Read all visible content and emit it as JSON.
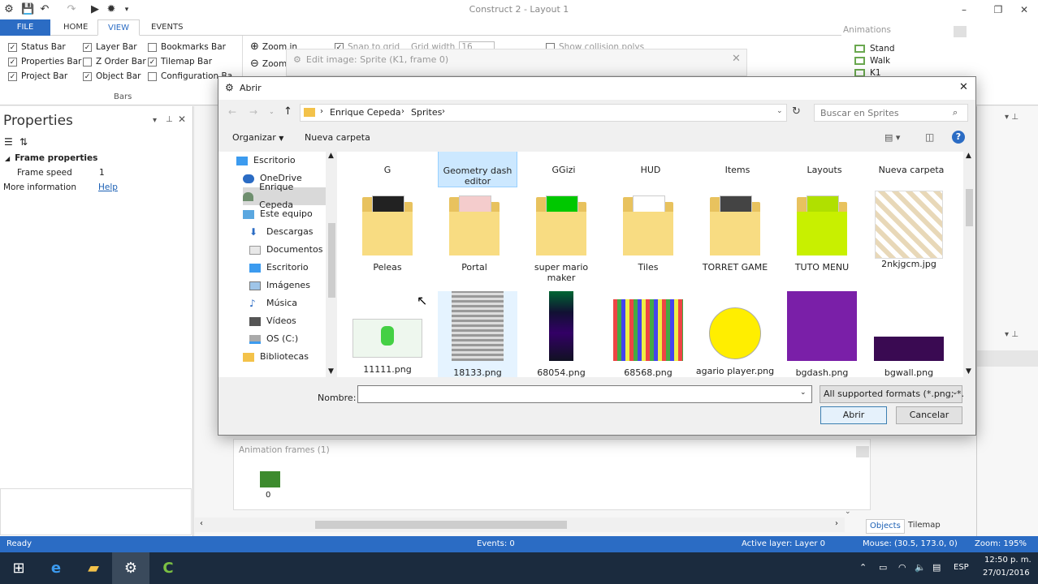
{
  "app": {
    "title": "Construct 2 - Layout 1"
  },
  "ribbon": {
    "tabs": [
      "FILE",
      "HOME",
      "VIEW",
      "EVENTS"
    ],
    "active_tab": "VIEW",
    "bars_group": {
      "label": "Bars",
      "col1": [
        {
          "label": "Status Bar",
          "checked": true
        },
        {
          "label": "Properties Bar",
          "checked": true
        },
        {
          "label": "Project Bar",
          "checked": true
        }
      ],
      "col2": [
        {
          "label": "Layer Bar",
          "checked": true
        },
        {
          "label": "Z Order Bar",
          "checked": false
        },
        {
          "label": "Object Bar",
          "checked": true
        }
      ],
      "col3": [
        {
          "label": "Bookmarks Bar",
          "checked": false
        },
        {
          "label": "Tilemap Bar",
          "checked": true
        },
        {
          "label": "Configuration Ba",
          "checked": false
        }
      ]
    },
    "zoom_in": "Zoom in",
    "zoom_out": "Zoom",
    "snap_to_grid": "Snap to grid",
    "grid_width": "Grid width",
    "grid_width_value": "16",
    "show_collision": "Show collision polys"
  },
  "edit_image": {
    "title": "Edit image: Sprite (K1, frame 0)"
  },
  "animations": {
    "title": "Animations",
    "items": [
      "Stand",
      "Walk",
      "K1"
    ]
  },
  "properties": {
    "title": "Properties",
    "section": "Frame properties",
    "rows": [
      {
        "label": "Frame speed",
        "value": "1"
      }
    ],
    "more_info_label": "More information",
    "more_info_link": "Help"
  },
  "anim_frames": {
    "title": "Animation frames (1)",
    "frame_label": "0"
  },
  "right_tabs": {
    "objects": "Objects",
    "tilemap": "Tilemap"
  },
  "status": {
    "ready": "Ready",
    "events": "Events: 0",
    "active_layer": "Active layer: Layer 0",
    "mouse": "Mouse: (30.5, 173.0, 0)",
    "zoom": "Zoom: 195%"
  },
  "dialog": {
    "title": "Abrir",
    "breadcrumb": [
      "Enrique Cepeda",
      "Sprites"
    ],
    "search_placeholder": "Buscar en Sprites",
    "organize": "Organizar",
    "new_folder": "Nueva carpeta",
    "nav": [
      {
        "label": "Escritorio",
        "icon": "desktop-icon",
        "indent": 0
      },
      {
        "label": "OneDrive",
        "icon": "cloud-icon",
        "indent": 1
      },
      {
        "label": "Enrique Cepeda",
        "icon": "user-icon",
        "indent": 1,
        "selected": true
      },
      {
        "label": "Este equipo",
        "icon": "computer-icon",
        "indent": 1
      },
      {
        "label": "Descargas",
        "icon": "download-icon",
        "indent": 2
      },
      {
        "label": "Documentos",
        "icon": "documents-icon",
        "indent": 2
      },
      {
        "label": "Escritorio",
        "icon": "desktop-icon",
        "indent": 2
      },
      {
        "label": "Imágenes",
        "icon": "pictures-icon",
        "indent": 2
      },
      {
        "label": "Música",
        "icon": "music-icon",
        "indent": 2
      },
      {
        "label": "Vídeos",
        "icon": "videos-icon",
        "indent": 2
      },
      {
        "label": "OS (C:)",
        "icon": "drive-icon",
        "indent": 2
      },
      {
        "label": "Bibliotecas",
        "icon": "library-icon",
        "indent": 1
      }
    ],
    "row0": [
      "G",
      "Geometry dash editor",
      "GGizi",
      "HUD",
      "Items",
      "Layouts",
      "Nueva carpeta"
    ],
    "row1": [
      {
        "label": "Peleas",
        "kind": "folder"
      },
      {
        "label": "Portal",
        "kind": "folder"
      },
      {
        "label": "super mario maker",
        "kind": "folder"
      },
      {
        "label": "Tiles",
        "kind": "folder"
      },
      {
        "label": "TORRET GAME",
        "kind": "folder"
      },
      {
        "label": "TUTO MENU",
        "kind": "folder"
      },
      {
        "label": "2nkjgcm.jpg",
        "kind": "image"
      }
    ],
    "row2": [
      {
        "label": "11111.png"
      },
      {
        "label": "18133.png"
      },
      {
        "label": "68054.png"
      },
      {
        "label": "68568.png"
      },
      {
        "label": "agario player.png"
      },
      {
        "label": "bgdash.png"
      },
      {
        "label": "bgwall.png"
      }
    ],
    "filename_label": "Nombre:",
    "filename_value": "",
    "filter": "All supported formats (*.png; *.",
    "open_button": "Abrir",
    "cancel_button": "Cancelar"
  },
  "taskbar": {
    "lang": "ESP",
    "time": "12:50 p. m.",
    "date": "27/01/2016"
  }
}
